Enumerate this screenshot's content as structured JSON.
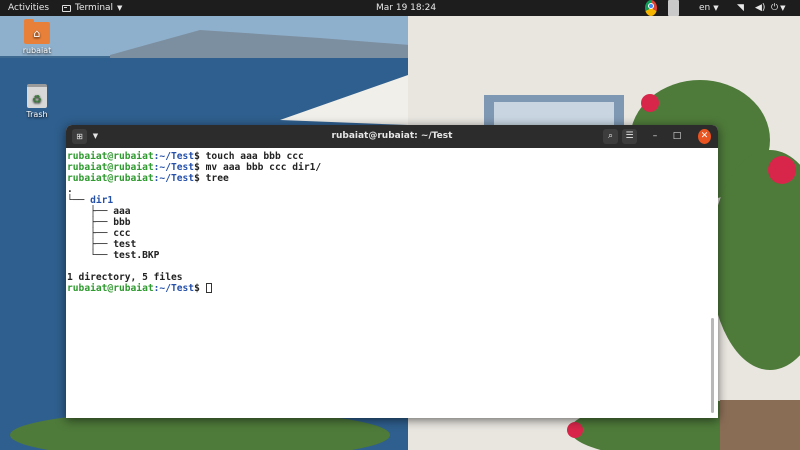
{
  "topbar": {
    "activities": "Activities",
    "app_name": "Terminal",
    "clock": "Mar 19  18:24",
    "language": "en"
  },
  "desktop": {
    "icons": [
      {
        "label": "rubaiat",
        "icon": "home-folder-icon",
        "color": "#e8803a"
      },
      {
        "label": "Trash",
        "icon": "trash-icon"
      }
    ]
  },
  "terminal": {
    "title": "rubaiat@rubaiat: ~/Test",
    "lines": [
      {
        "kind": "prompt",
        "user": "rubaiat@rubaiat",
        "path": ":~/Test",
        "sigil": "$",
        "command": "touch aaa bbb ccc"
      },
      {
        "kind": "prompt",
        "user": "rubaiat@rubaiat",
        "path": ":~/Test",
        "sigil": "$",
        "command": "mv aaa bbb ccc dir1/"
      },
      {
        "kind": "prompt",
        "user": "rubaiat@rubaiat",
        "path": ":~/Test",
        "sigil": "$",
        "command": "tree"
      },
      {
        "kind": "text",
        "text": "."
      },
      {
        "kind": "tree",
        "branch": "└── ",
        "name": "dir1",
        "is_dir": true
      },
      {
        "kind": "tree",
        "branch": "    ├── ",
        "name": "aaa"
      },
      {
        "kind": "tree",
        "branch": "    ├── ",
        "name": "bbb"
      },
      {
        "kind": "tree",
        "branch": "    ├── ",
        "name": "ccc"
      },
      {
        "kind": "tree",
        "branch": "    ├── ",
        "name": "test"
      },
      {
        "kind": "tree",
        "branch": "    └── ",
        "name": "test.BKP"
      },
      {
        "kind": "text",
        "text": ""
      },
      {
        "kind": "text",
        "text": "1 directory, 5 files"
      },
      {
        "kind": "prompt",
        "user": "rubaiat@rubaiat",
        "path": ":~/Test",
        "sigil": "$",
        "command": "",
        "cursor": true
      }
    ]
  },
  "colors": {
    "prompt_user": "#2f9a2f",
    "prompt_path": "#2550a8",
    "close_button": "#e95420",
    "titlebar": "#2c2c2c"
  }
}
